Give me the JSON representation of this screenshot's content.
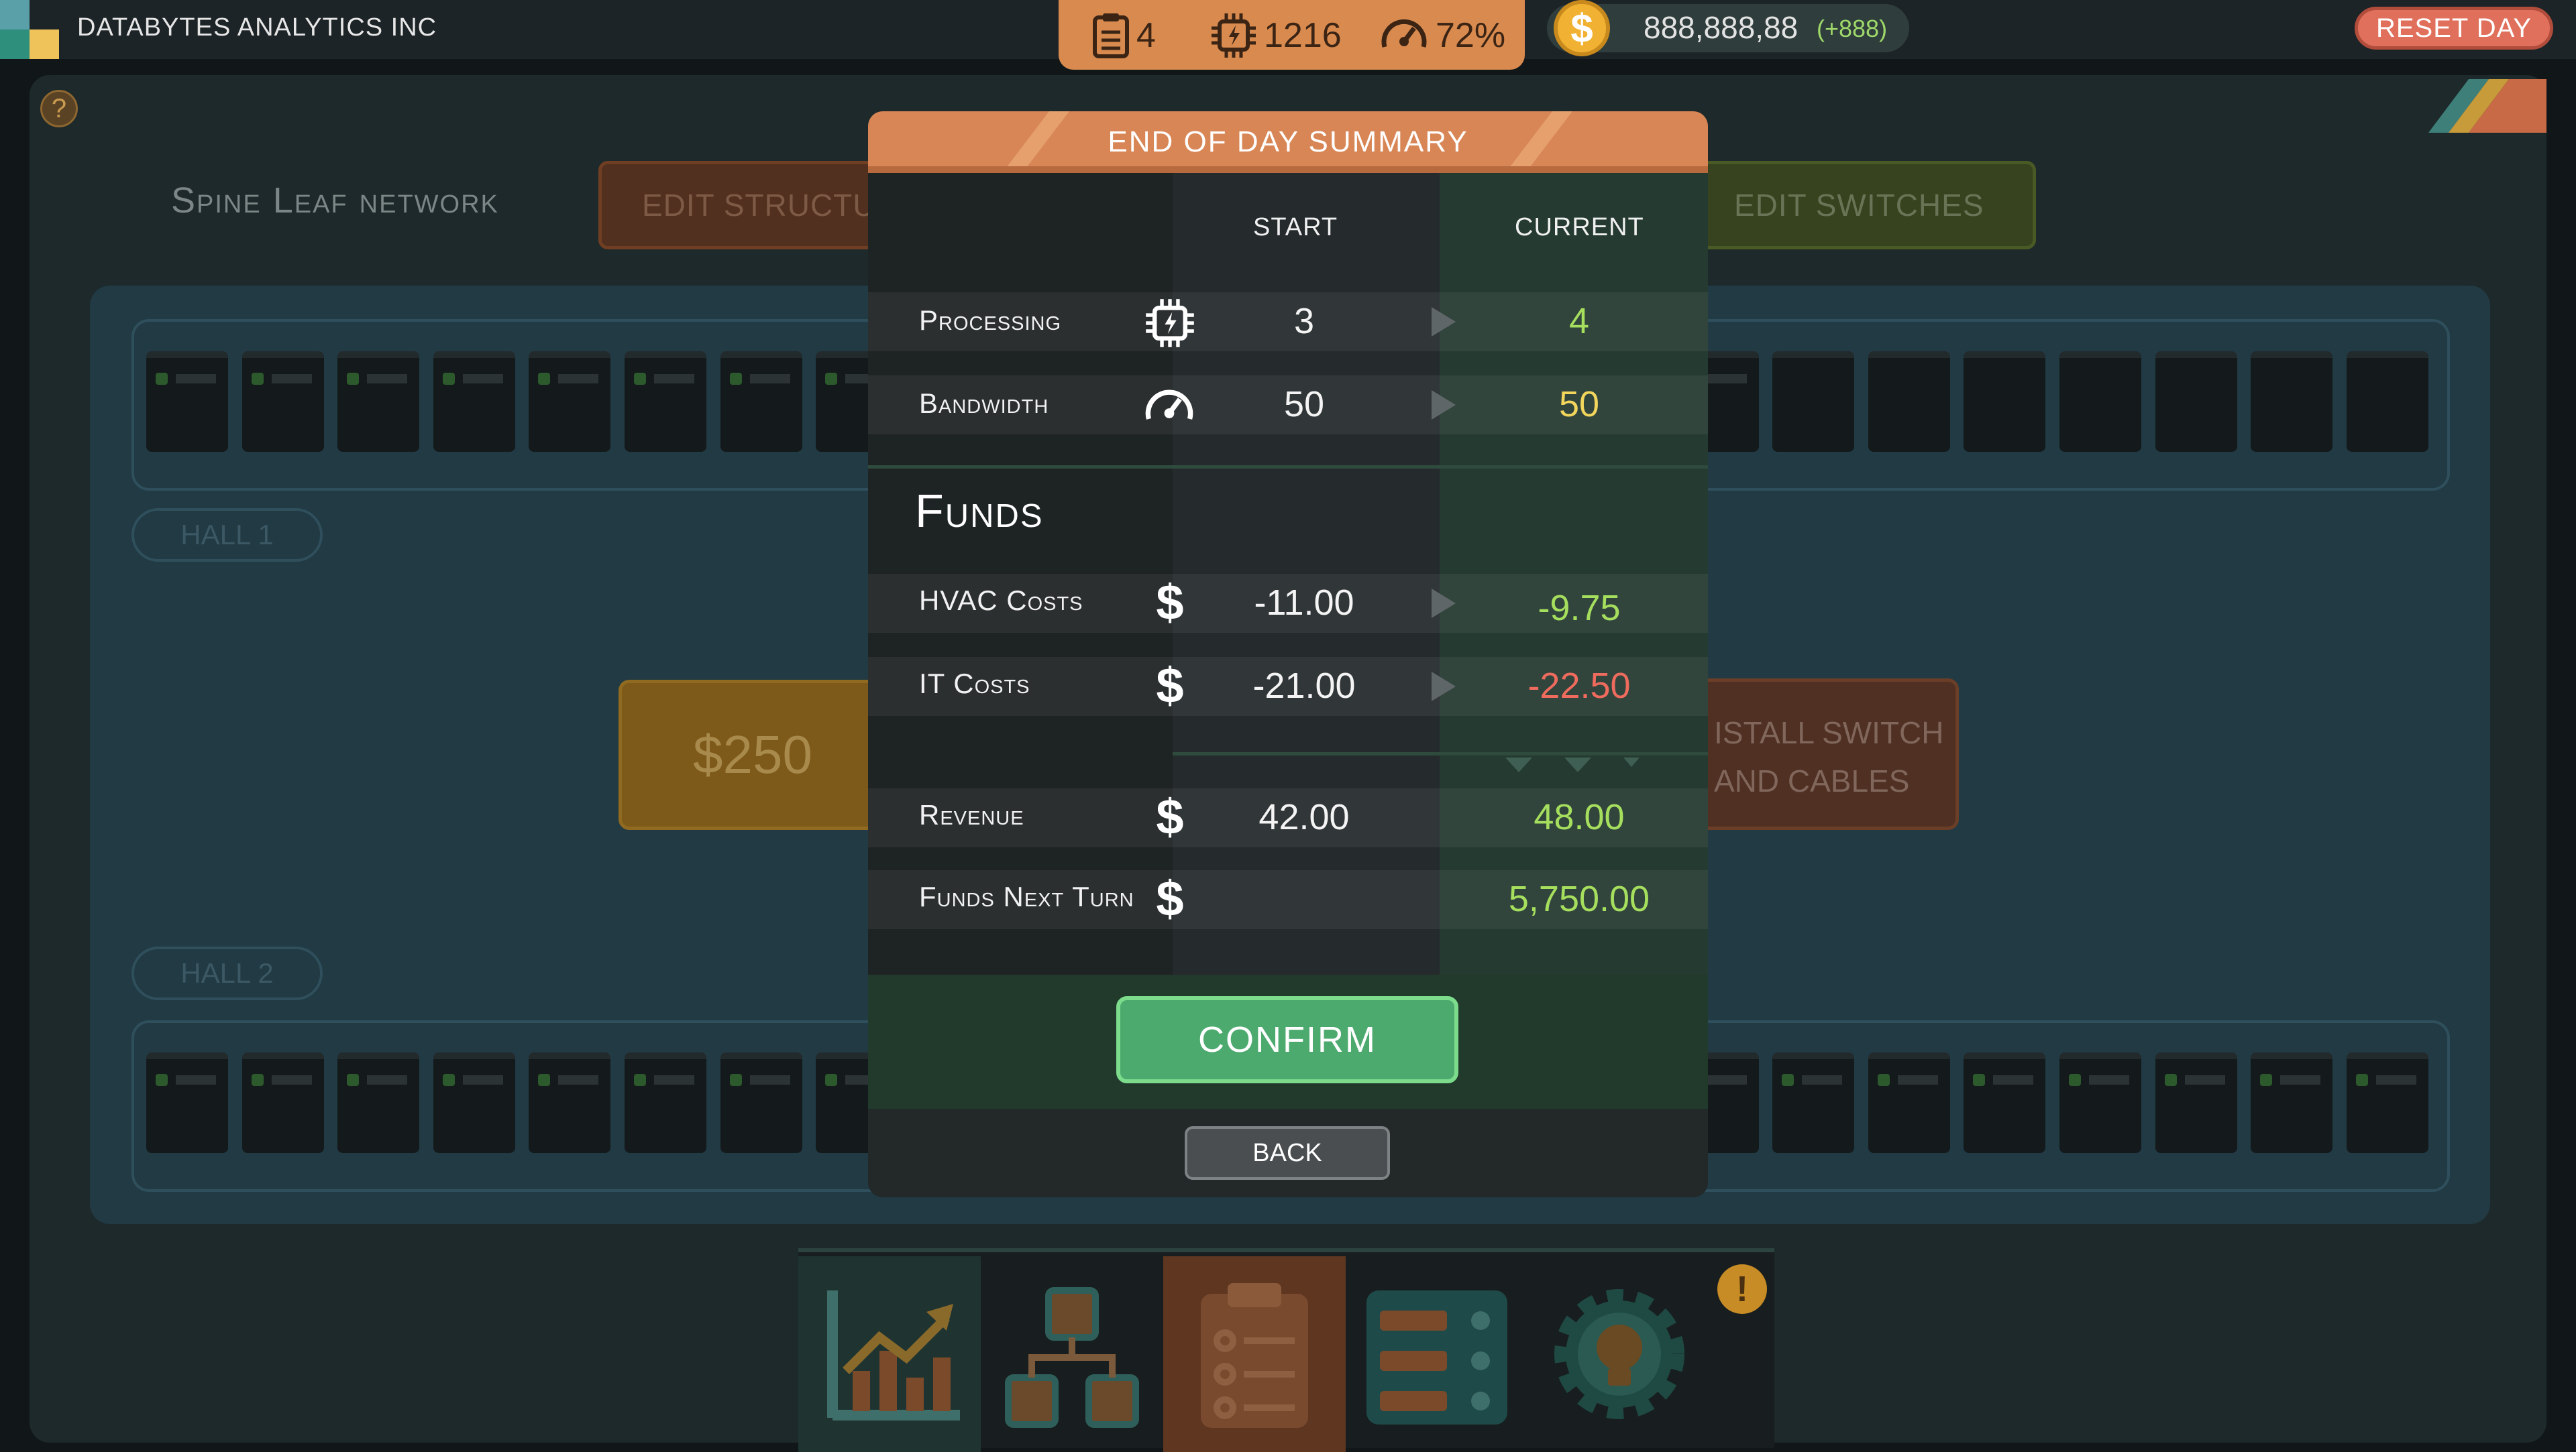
{
  "company": {
    "name": "DATABYTES ANALYTICS INC"
  },
  "stats": {
    "clipboard": "4",
    "processing": "1216",
    "bandwidth": "72%"
  },
  "funds": {
    "amount": "888,888,88",
    "delta": "(+888)",
    "currency_symbol": "$"
  },
  "reset_button": "RESET DAY",
  "help_symbol": "?",
  "scene": {
    "title": "Spine Leaf network",
    "edit_structure": "EDIT STRUCTUR",
    "edit_switches": "EDIT SWITCHES",
    "hall1": "HALL 1",
    "hall2": "HALL 2",
    "price": "$250",
    "install_line1": "ISTALL SWITCH",
    "install_line2": "AND CABLES"
  },
  "tabs": [
    "chart-icon",
    "network-icon",
    "clipboard-icon",
    "server-rack-icon",
    "idea-gear-icon"
  ],
  "alert_symbol": "!",
  "modal": {
    "title": "END OF DAY SUMMARY",
    "col_start": "START",
    "col_current": "CURRENT",
    "rows": [
      {
        "label": "Processing",
        "icon": "chip-icon",
        "start": "3",
        "current": "4"
      },
      {
        "label": "Bandwidth",
        "icon": "gauge-icon",
        "start": "50",
        "current": "50"
      }
    ],
    "funds_title": "Funds",
    "fund_rows": [
      {
        "label": "HVAC Costs",
        "start": "-11.00",
        "current": "-9.75"
      },
      {
        "label": "IT Costs",
        "start": "-21.00",
        "current": "-22.50"
      },
      {
        "label": "Revenue",
        "start": "42.00",
        "current": "48.00"
      },
      {
        "label": "Funds Next Turn",
        "start": "",
        "current": "5,750.00"
      }
    ],
    "dollar_symbol": "$",
    "confirm": "CONFIRM",
    "back": "BACK"
  },
  "colors": {
    "accent_orange": "#d88656",
    "confirm_green": "#4daa6f",
    "positive": "#a6df5e",
    "neutral": "#f2d55c",
    "negative": "#ef6b5e"
  }
}
